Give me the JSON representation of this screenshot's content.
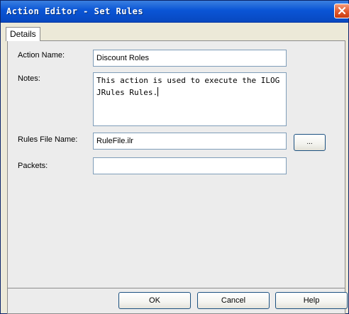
{
  "window": {
    "title": "Action Editor - Set Rules"
  },
  "tabs": [
    {
      "label": "Details",
      "selected": true
    }
  ],
  "form": {
    "action_name": {
      "label": "Action Name:",
      "value": "Discount Roles"
    },
    "notes": {
      "label": "Notes:",
      "value": "This action is used to execute the ILOG JRules Rules."
    },
    "rules_file_name": {
      "label": "Rules File Name:",
      "value": "RuleFile.ilr",
      "browse_label": "..."
    },
    "packets": {
      "label": "Packets:",
      "value": ""
    }
  },
  "buttons": {
    "ok": "OK",
    "cancel": "Cancel",
    "help": "Help"
  },
  "colors": {
    "titlebar": "#0a55d6",
    "close": "#e0582c",
    "input_border": "#7f9db9",
    "button_border": "#1c5180"
  }
}
